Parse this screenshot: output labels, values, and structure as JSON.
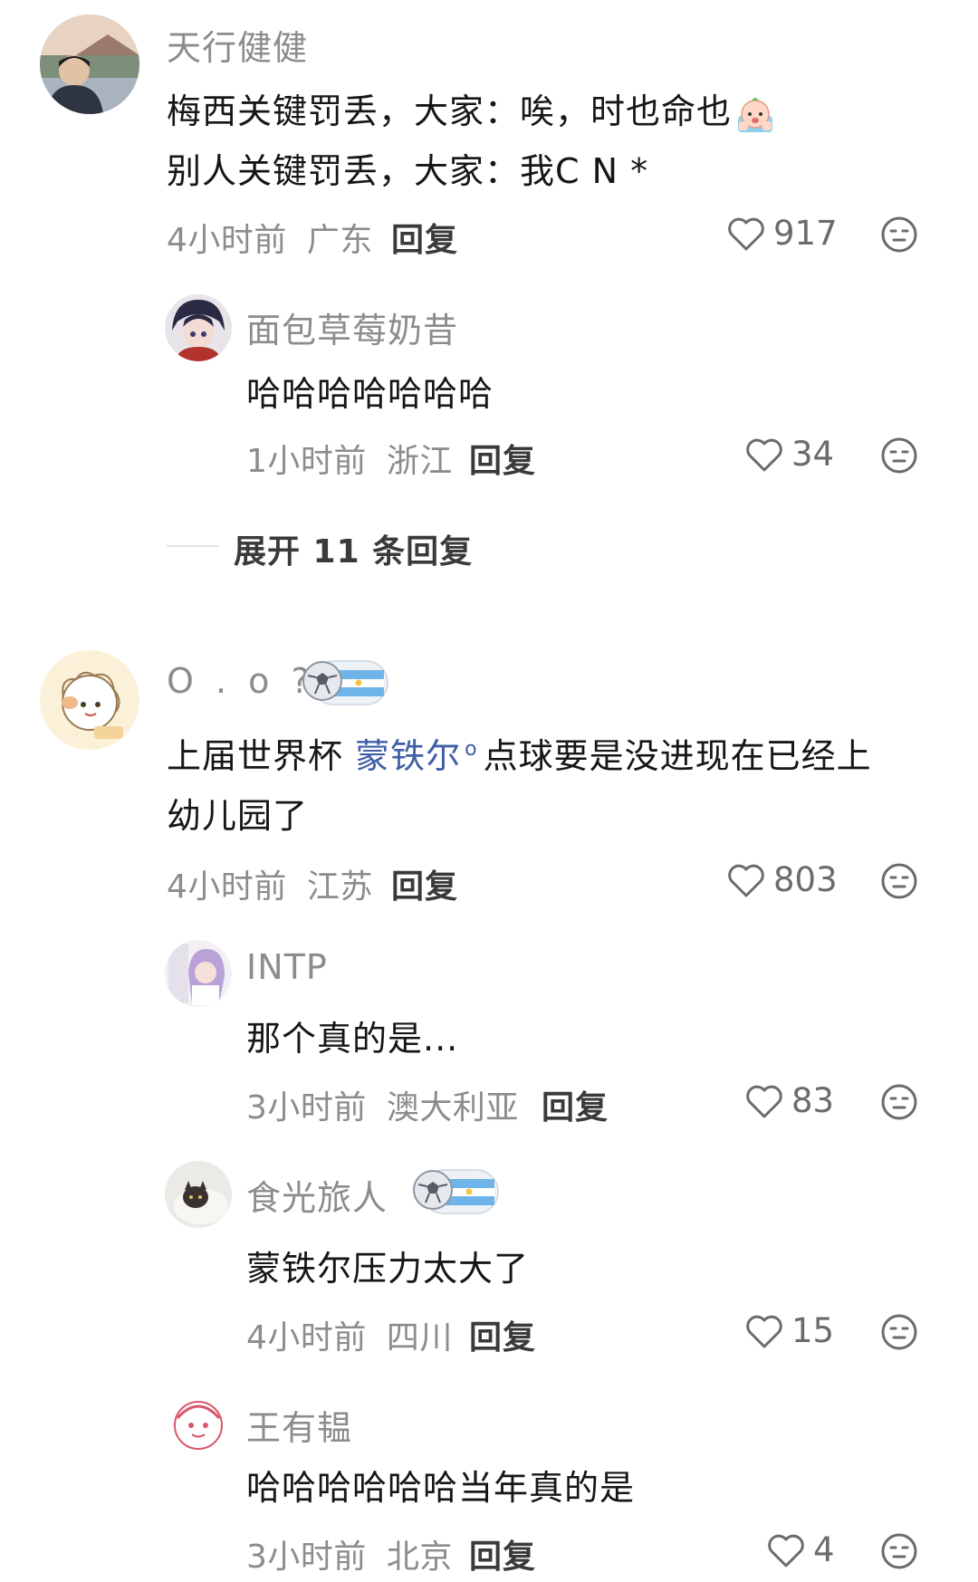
{
  "comments": [
    {
      "user": "天行健健",
      "line1": "梅西关键罚丢，大家：唉，时也命也",
      "line2": "别人关键罚丢，大家：我C N *",
      "inline_emoji": "crying-face-emoji",
      "time": "4小时前",
      "location": "广东",
      "reply_label": "回复",
      "likes": "917",
      "replies": [
        {
          "user": "面包草莓奶昔",
          "text": "哈哈哈哈哈哈哈",
          "time": "1小时前",
          "location": "浙江",
          "reply_label": "回复",
          "likes": "34"
        }
      ],
      "expand_label": "展开 11 条回复"
    },
    {
      "user": "O . o ?",
      "badge": "argentina-football-badge",
      "line1_pre": "上届世界杯 ",
      "line1_link": "蒙铁尔",
      "line1_post": "点球要是没进现在已经上",
      "line2": "幼儿园了",
      "time": "4小时前",
      "location": "江苏",
      "reply_label": "回复",
      "likes": "803",
      "replies": [
        {
          "user": "INTP",
          "text": "那个真的是...",
          "time": "3小时前",
          "location": "澳大利亚",
          "reply_label": "回复",
          "likes": "83"
        },
        {
          "user": "食光旅人",
          "badge": "argentina-football-badge",
          "text": "蒙铁尔压力太大了",
          "time": "4小时前",
          "location": "四川",
          "reply_label": "回复",
          "likes": "15"
        },
        {
          "user": "王有韫",
          "text": "哈哈哈哈哈哈当年真的是",
          "time": "3小时前",
          "location": "北京",
          "reply_label": "回复",
          "likes": "4"
        }
      ]
    }
  ],
  "colors": {
    "meta": "#8c8c8c",
    "link": "#3f5fa8",
    "text": "#161616"
  }
}
